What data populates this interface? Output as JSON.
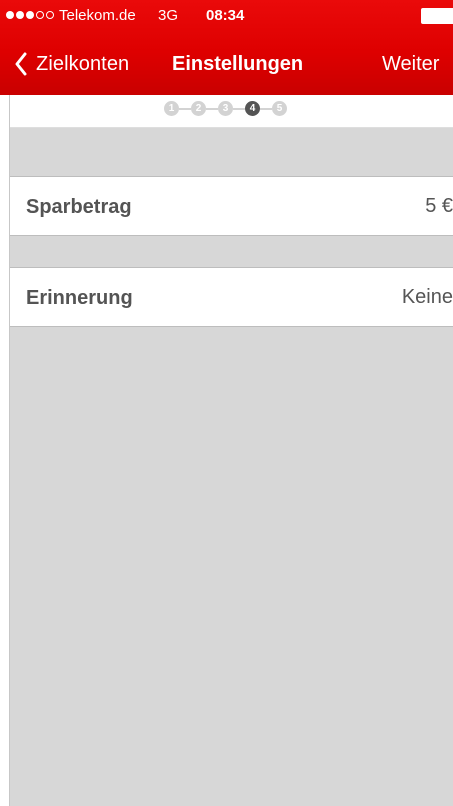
{
  "status": {
    "carrier": "Telekom.de",
    "network": "3G",
    "time": "08:34",
    "signal_dots": [
      true,
      true,
      true,
      false,
      false
    ]
  },
  "nav": {
    "back_label": "Zielkonten",
    "title": "Einstellungen",
    "next_label": "Weiter"
  },
  "stepper": {
    "steps": [
      "1",
      "2",
      "3",
      "4",
      "5"
    ],
    "active_step": 4
  },
  "settings": {
    "rows": [
      {
        "label": "Sparbetrag",
        "value": "5 €"
      },
      {
        "label": "Erinnerung",
        "value": "Keine"
      }
    ]
  },
  "colors": {
    "header_red": "#de0000",
    "step_active": "#545454",
    "step_inactive": "#d3d3d3",
    "background": "#d7d7d7"
  }
}
